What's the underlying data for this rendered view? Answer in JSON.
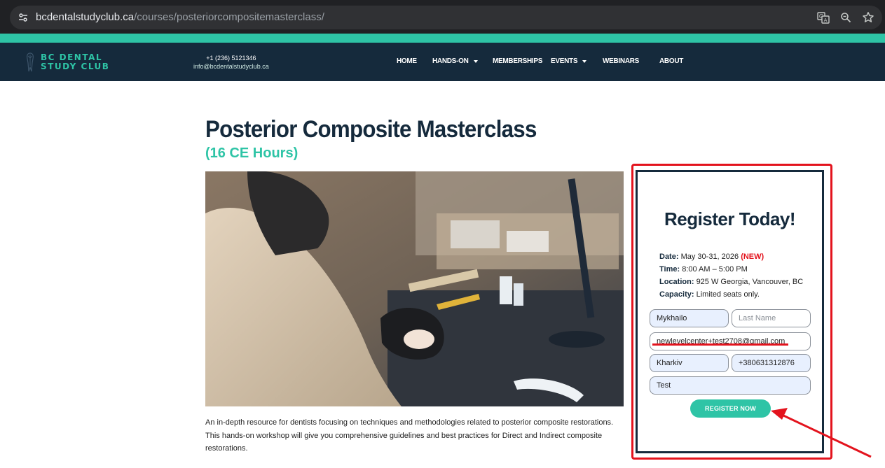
{
  "browser": {
    "url_domain": "bcdentalstudyclub.ca",
    "url_path": "/courses/posteriorcompositemasterclass/"
  },
  "header": {
    "logo_line1": "BC DENTAL",
    "logo_line2": "STUDY CLUB",
    "phone": "+1 (236) 5121346",
    "email": "info@bcdentalstudyclub.ca",
    "nav": [
      {
        "label": "HOME",
        "has_dropdown": false
      },
      {
        "label": "HANDS-ON",
        "has_dropdown": true
      },
      {
        "label": "MEMBERSHIPS",
        "has_dropdown": false
      },
      {
        "label": "EVENTS",
        "has_dropdown": true
      },
      {
        "label": "WEBINARS",
        "has_dropdown": false
      },
      {
        "label": "ABOUT",
        "has_dropdown": false
      }
    ]
  },
  "main": {
    "title": "Posterior Composite Masterclass",
    "subtitle": "(16 CE Hours)",
    "description": "An in-depth resource for dentists focusing on techniques and methodologies related to posterior composite restorations. This hands-on workshop will give you comprehensive guidelines and best practices for Direct and Indirect composite restorations."
  },
  "register": {
    "title": "Register Today!",
    "date_label": "Date:",
    "date_value": "May 30-31, 2026",
    "date_badge": "(NEW)",
    "time_label": "Time:",
    "time_value": "8:00 AM – 5:00 PM",
    "location_label": "Location:",
    "location_value": "925 W Georgia, Vancouver, BC",
    "capacity_label": "Capacity:",
    "capacity_value": "Limited seats only.",
    "first_name": "Mykhailo",
    "last_name_placeholder": "Last Name",
    "email_value": "newlevelcenter+test2708@gmail.com",
    "city": "Kharkiv",
    "phone": "+380631312876",
    "message": "Test",
    "button": "REGISTER NOW"
  },
  "colors": {
    "navy": "#152a3c",
    "teal": "#2ec4a6",
    "annotation_red": "#e3131d"
  }
}
